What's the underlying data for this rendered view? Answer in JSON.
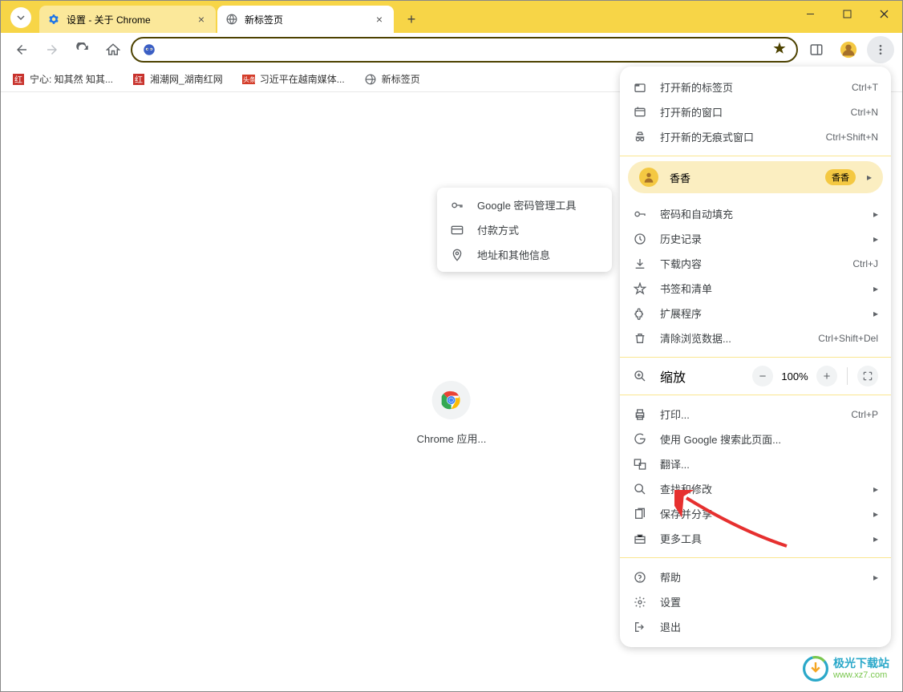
{
  "tabs": {
    "items": [
      {
        "title": "设置 - 关于 Chrome",
        "icon": "settings-icon",
        "color": "#1a73e8"
      },
      {
        "title": "新标签页",
        "icon": "globe-icon",
        "color": "#5f6368"
      }
    ],
    "active_index": 1
  },
  "address_bar": {
    "value": ""
  },
  "bookmarks": {
    "items": [
      {
        "label": "宁心: 知其然 知其...",
        "icon": "red"
      },
      {
        "label": "湘潮网_湖南红网",
        "icon": "red"
      },
      {
        "label": "习近平在越南媒体...",
        "icon": "toutiao"
      },
      {
        "label": "新标签页",
        "icon": "globe"
      }
    ]
  },
  "content": {
    "app_label": "Chrome 应用..."
  },
  "submenu": {
    "items": [
      {
        "label": "Google 密码管理工具",
        "icon": "key"
      },
      {
        "label": "付款方式",
        "icon": "card"
      },
      {
        "label": "地址和其他信息",
        "icon": "location"
      }
    ]
  },
  "menu": {
    "section1": [
      {
        "label": "打开新的标签页",
        "icon": "tab",
        "shortcut": "Ctrl+T"
      },
      {
        "label": "打开新的窗口",
        "icon": "window",
        "shortcut": "Ctrl+N"
      },
      {
        "label": "打开新的无痕式窗口",
        "icon": "incognito",
        "shortcut": "Ctrl+Shift+N"
      }
    ],
    "profile": {
      "name": "香香",
      "badge": "香香"
    },
    "section2": [
      {
        "label": "密码和自动填充",
        "icon": "key",
        "has_submenu": true
      },
      {
        "label": "历史记录",
        "icon": "history",
        "has_submenu": true
      },
      {
        "label": "下载内容",
        "icon": "download",
        "shortcut": "Ctrl+J"
      },
      {
        "label": "书签和清单",
        "icon": "star",
        "has_submenu": true
      },
      {
        "label": "扩展程序",
        "icon": "extension",
        "has_submenu": true
      },
      {
        "label": "清除浏览数据...",
        "icon": "trash",
        "shortcut": "Ctrl+Shift+Del"
      }
    ],
    "zoom": {
      "label": "缩放",
      "value": "100%"
    },
    "section3": [
      {
        "label": "打印...",
        "icon": "print",
        "shortcut": "Ctrl+P"
      },
      {
        "label": "使用 Google 搜索此页面...",
        "icon": "google"
      },
      {
        "label": "翻译...",
        "icon": "translate"
      },
      {
        "label": "查找和修改",
        "icon": "search",
        "has_submenu": true
      },
      {
        "label": "保存并分享",
        "icon": "share",
        "has_submenu": true
      },
      {
        "label": "更多工具",
        "icon": "toolbox",
        "has_submenu": true
      }
    ],
    "section4": [
      {
        "label": "帮助",
        "icon": "help",
        "has_submenu": true
      },
      {
        "label": "设置",
        "icon": "settings"
      },
      {
        "label": "退出",
        "icon": "exit"
      }
    ]
  },
  "watermark": {
    "title": "极光下载站",
    "url": "www.xz7.com"
  }
}
